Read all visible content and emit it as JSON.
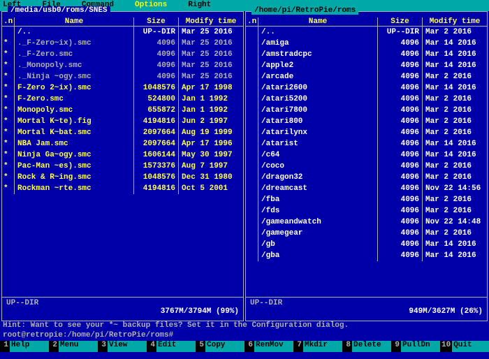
{
  "menu": {
    "left": "Left",
    "file": "File",
    "command": "Command",
    "options": "Options",
    "right": "Right"
  },
  "left_panel": {
    "path": "/media/usb0/roms/SNES",
    "active": false,
    "headers": {
      "n": ".n",
      "name": "Name",
      "size": "Size",
      "mod": "Modify time"
    },
    "rows": [
      {
        "sel": "",
        "name": "/..",
        "size": "UP--DIR",
        "mod": "Mar 25  2016",
        "kind": "dir"
      },
      {
        "sel": "*",
        "name": "._F-Zero~ix).smc",
        "size": "4096",
        "mod": "Mar 25  2016",
        "kind": "file"
      },
      {
        "sel": "*",
        "name": "._F-Zero.smc",
        "size": "4096",
        "mod": "Mar 25  2016",
        "kind": "file"
      },
      {
        "sel": "*",
        "name": "._Monopoly.smc",
        "size": "4096",
        "mod": "Mar 25  2016",
        "kind": "file"
      },
      {
        "sel": "*",
        "name": "._Ninja ~ogy.smc",
        "size": "4096",
        "mod": "Mar 25  2016",
        "kind": "file"
      },
      {
        "sel": "*",
        "name": "F-Zero 2~ix).smc",
        "size": "1048576",
        "mod": "Apr 17  1998",
        "kind": "marked"
      },
      {
        "sel": "*",
        "name": "F-Zero.smc",
        "size": "524800",
        "mod": "Jan  1  1992",
        "kind": "marked"
      },
      {
        "sel": "*",
        "name": "Monopoly.smc",
        "size": "655872",
        "mod": "Jan  1  1992",
        "kind": "marked"
      },
      {
        "sel": "*",
        "name": "Mortal K~te).fig",
        "size": "4194816",
        "mod": "Jun  2  1997",
        "kind": "marked"
      },
      {
        "sel": "*",
        "name": "Mortal K~bat.smc",
        "size": "2097664",
        "mod": "Aug 19  1999",
        "kind": "marked"
      },
      {
        "sel": "*",
        "name": "NBA Jam.smc",
        "size": "2097664",
        "mod": "Apr 17  1996",
        "kind": "marked"
      },
      {
        "sel": "*",
        "name": "Ninja Ga~ogy.smc",
        "size": "1606144",
        "mod": "May 30  1997",
        "kind": "marked"
      },
      {
        "sel": "*",
        "name": "Pac-Man ~es).smc",
        "size": "1573376",
        "mod": "Aug  7  1997",
        "kind": "marked"
      },
      {
        "sel": "*",
        "name": "Rock & R~ing.smc",
        "size": "1048576",
        "mod": "Dec 31  1980",
        "kind": "marked"
      },
      {
        "sel": "*",
        "name": "Rockman ~rte.smc",
        "size": "4194816",
        "mod": "Oct  5  2001",
        "kind": "marked"
      }
    ],
    "footer_status": "UP--DIR",
    "footer_disk": "3767M/3794M (99%)"
  },
  "right_panel": {
    "path": "/home/pi/RetroPie/roms",
    "active": true,
    "headers": {
      "n": ".n",
      "name": "Name",
      "size": "Size",
      "mod": "Modify time"
    },
    "rows": [
      {
        "sel": "",
        "name": "/..",
        "size": "UP--DIR",
        "mod": "Mar  2  2016",
        "kind": "dir"
      },
      {
        "sel": "",
        "name": "/amiga",
        "size": "4096",
        "mod": "Mar 14  2016",
        "kind": "dir"
      },
      {
        "sel": "",
        "name": "/amstradcpc",
        "size": "4096",
        "mod": "Mar 14  2016",
        "kind": "dir"
      },
      {
        "sel": "",
        "name": "/apple2",
        "size": "4096",
        "mod": "Mar 14  2016",
        "kind": "dir"
      },
      {
        "sel": "",
        "name": "/arcade",
        "size": "4096",
        "mod": "Mar  2  2016",
        "kind": "dir"
      },
      {
        "sel": "",
        "name": "/atari2600",
        "size": "4096",
        "mod": "Mar 14  2016",
        "kind": "dir"
      },
      {
        "sel": "",
        "name": "/atari5200",
        "size": "4096",
        "mod": "Mar  2  2016",
        "kind": "dir"
      },
      {
        "sel": "",
        "name": "/atari7800",
        "size": "4096",
        "mod": "Mar  2  2016",
        "kind": "dir"
      },
      {
        "sel": "",
        "name": "/atari800",
        "size": "4096",
        "mod": "Mar  2  2016",
        "kind": "dir"
      },
      {
        "sel": "",
        "name": "/atarilynx",
        "size": "4096",
        "mod": "Mar  2  2016",
        "kind": "dir"
      },
      {
        "sel": "",
        "name": "/atarist",
        "size": "4096",
        "mod": "Mar 14  2016",
        "kind": "dir"
      },
      {
        "sel": "",
        "name": "/c64",
        "size": "4096",
        "mod": "Mar 14  2016",
        "kind": "dir"
      },
      {
        "sel": "",
        "name": "/coco",
        "size": "4096",
        "mod": "Mar  2  2016",
        "kind": "dir"
      },
      {
        "sel": "",
        "name": "/dragon32",
        "size": "4096",
        "mod": "Mar  2  2016",
        "kind": "dir"
      },
      {
        "sel": "",
        "name": "/dreamcast",
        "size": "4096",
        "mod": "Nov 22 14:56",
        "kind": "dir"
      },
      {
        "sel": "",
        "name": "/fba",
        "size": "4096",
        "mod": "Mar  2  2016",
        "kind": "dir"
      },
      {
        "sel": "",
        "name": "/fds",
        "size": "4096",
        "mod": "Mar  2  2016",
        "kind": "dir"
      },
      {
        "sel": "",
        "name": "/gameandwatch",
        "size": "4096",
        "mod": "Nov 22 14:48",
        "kind": "dir"
      },
      {
        "sel": "",
        "name": "/gamegear",
        "size": "4096",
        "mod": "Mar  2  2016",
        "kind": "dir"
      },
      {
        "sel": "",
        "name": "/gb",
        "size": "4096",
        "mod": "Mar 14  2016",
        "kind": "dir"
      },
      {
        "sel": "",
        "name": "/gba",
        "size": "4096",
        "mod": "Mar 14  2016",
        "kind": "dir"
      }
    ],
    "footer_status": "UP--DIR",
    "footer_disk": "949M/3627M (26%)"
  },
  "hint": "Hint: Want to see your *~ backup files? Set it in the Configuration dialog.",
  "prompt": "root@retropie:/home/pi/RetroPie/roms#",
  "fkeys": [
    {
      "n": "1",
      "l": "Help"
    },
    {
      "n": "2",
      "l": "Menu"
    },
    {
      "n": "3",
      "l": "View"
    },
    {
      "n": "4",
      "l": "Edit"
    },
    {
      "n": "5",
      "l": "Copy"
    },
    {
      "n": "6",
      "l": "RenMov"
    },
    {
      "n": "7",
      "l": "Mkdir"
    },
    {
      "n": "8",
      "l": "Delete"
    },
    {
      "n": "9",
      "l": "PullDn"
    },
    {
      "n": "10",
      "l": "Quit"
    }
  ]
}
